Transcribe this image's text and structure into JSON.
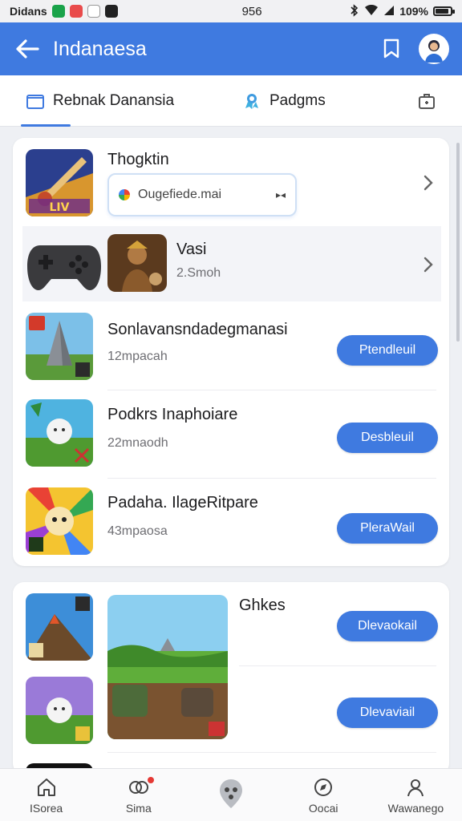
{
  "status_bar": {
    "carrier": "Didans",
    "time": "956",
    "battery": "109%",
    "battery_level": 0.9
  },
  "app_bar": {
    "title": "Indanaesa"
  },
  "tabs": [
    {
      "label": "Rebnak Danansia"
    },
    {
      "label": "Padgms"
    }
  ],
  "card1": {
    "row1": {
      "title": "Thogktin",
      "search_value": "Ougefiede.mai",
      "search_trail": "▸◂"
    },
    "row2": {
      "title": "Vasi",
      "subtitle": "2.Smoh"
    },
    "apps": [
      {
        "title": "Sonlavansndadegmanasi",
        "subtitle": "12mpacah",
        "button": "Ptendleuil"
      },
      {
        "title": "Podkrs Inaphoiare",
        "subtitle": "22mnaodh",
        "button": "Desbleuil"
      },
      {
        "title": "Padaha. IlageRitpare",
        "subtitle": "43mpaosa",
        "button": "PleraWail"
      }
    ]
  },
  "card2": {
    "title": "Ghkes",
    "buttons": [
      "Dlevaokail",
      "Dlevaviail"
    ]
  },
  "bottom_nav": [
    {
      "label": "ISorea",
      "icon": "home-icon"
    },
    {
      "label": "Sima",
      "icon": "games-icon"
    },
    {
      "label": "",
      "icon": "location-icon"
    },
    {
      "label": "Oocai",
      "icon": "compass-icon"
    },
    {
      "label": "Wawanego",
      "icon": "profile-icon"
    }
  ],
  "colors": {
    "accent": "#3f7ae0",
    "badge": "#e53935"
  }
}
